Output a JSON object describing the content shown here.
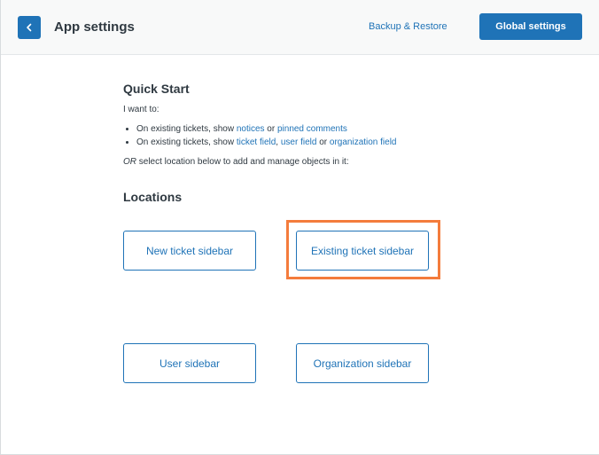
{
  "header": {
    "title": "App settings",
    "backup_link": "Backup & Restore",
    "global_button": "Global settings"
  },
  "quick_start": {
    "heading": "Quick Start",
    "intro": "I want to:",
    "line1": {
      "prefix": "On existing tickets, show ",
      "link1": "notices",
      "sep1": " or ",
      "link2": "pinned comments"
    },
    "line2": {
      "prefix": "On existing tickets, show ",
      "link1": "ticket field",
      "sep1": ", ",
      "link2": "user field",
      "sep2": " or ",
      "link3": "organization field"
    },
    "or_prefix": "OR",
    "or_text": " select location below to add and manage objects in it:"
  },
  "locations": {
    "heading": "Locations",
    "new_ticket": "New ticket sidebar",
    "existing_ticket": "Existing ticket sidebar",
    "user": "User sidebar",
    "organization": "Organization sidebar"
  },
  "colors": {
    "accent": "#1f73b7",
    "highlight": "#f47c3c"
  }
}
